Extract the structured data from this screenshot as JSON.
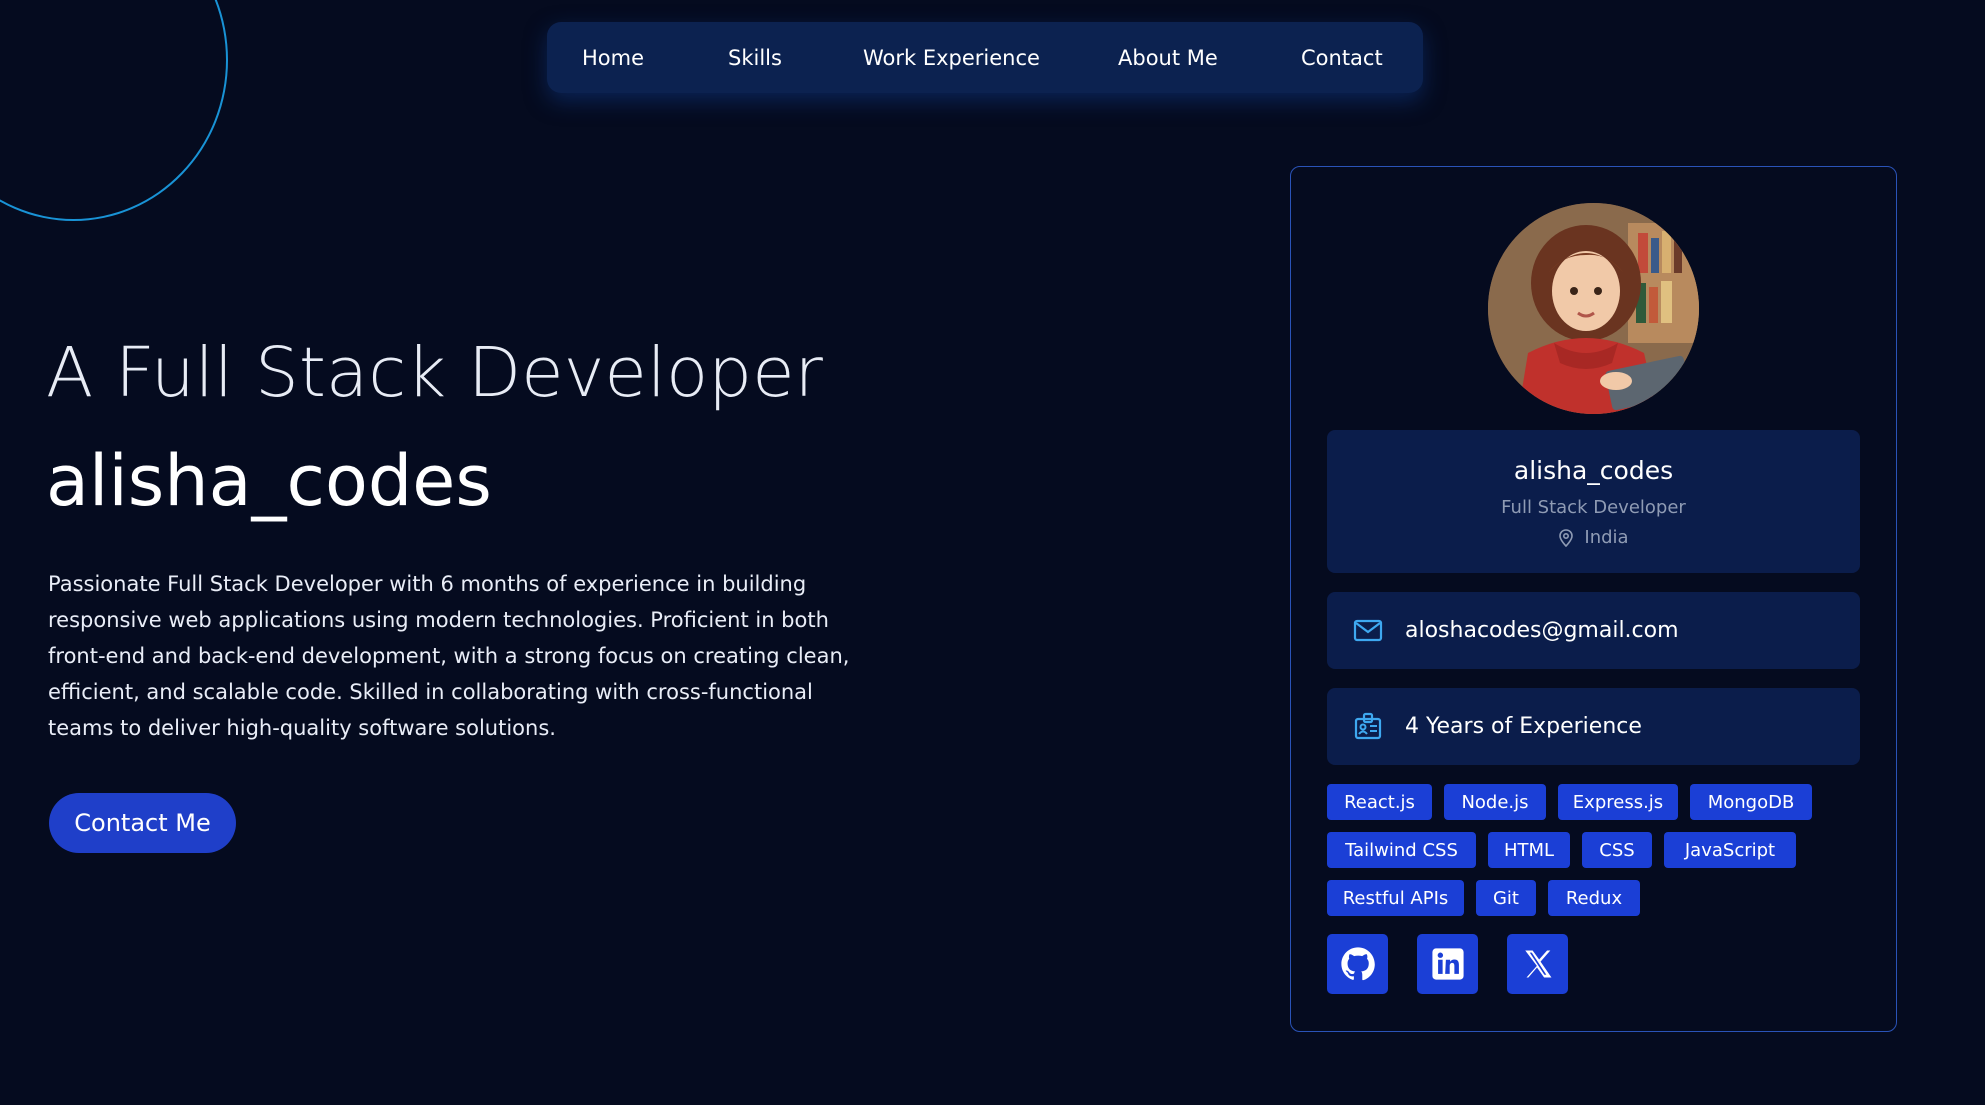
{
  "nav": {
    "items": [
      {
        "label": "Home"
      },
      {
        "label": "Skills"
      },
      {
        "label": "Work Experience"
      },
      {
        "label": "About Me"
      },
      {
        "label": "Contact"
      }
    ]
  },
  "hero": {
    "subtitle": "A Full Stack Developer",
    "title": "alisha_codes",
    "description": "Passionate Full Stack Developer with 6 months of experience in building responsive web applications using modern technologies. Proficient in both front-end and back-end development, with a strong focus on creating clean, efficient, and scalable code. Skilled in collaborating with cross-functional teams to deliver high-quality software solutions.",
    "cta_label": "Contact Me"
  },
  "profile": {
    "avatar_icon": "avatar-illustration",
    "name": "alisha_codes",
    "role": "Full Stack Developer",
    "location": "India",
    "email": "aloshacodes@gmail.com",
    "experience": "4 Years of Experience",
    "skills": [
      "React.js",
      "Node.js",
      "Express.js",
      "MongoDB",
      "Tailwind CSS",
      "HTML",
      "CSS",
      "JavaScript",
      "Restful APIs",
      "Git",
      "Redux"
    ],
    "socials": [
      {
        "icon": "github-icon"
      },
      {
        "icon": "linkedin-icon"
      },
      {
        "icon": "x-icon"
      }
    ]
  },
  "colors": {
    "background": "#050b1f",
    "nav_bg": "#0c2250",
    "card_panel": "#0b1d4b",
    "accent": "#1b3fd6",
    "card_border": "#2a53b8",
    "ring": "#1a9be0",
    "icon_accent": "#3ea8f0",
    "muted_text": "#8f9bb4"
  }
}
